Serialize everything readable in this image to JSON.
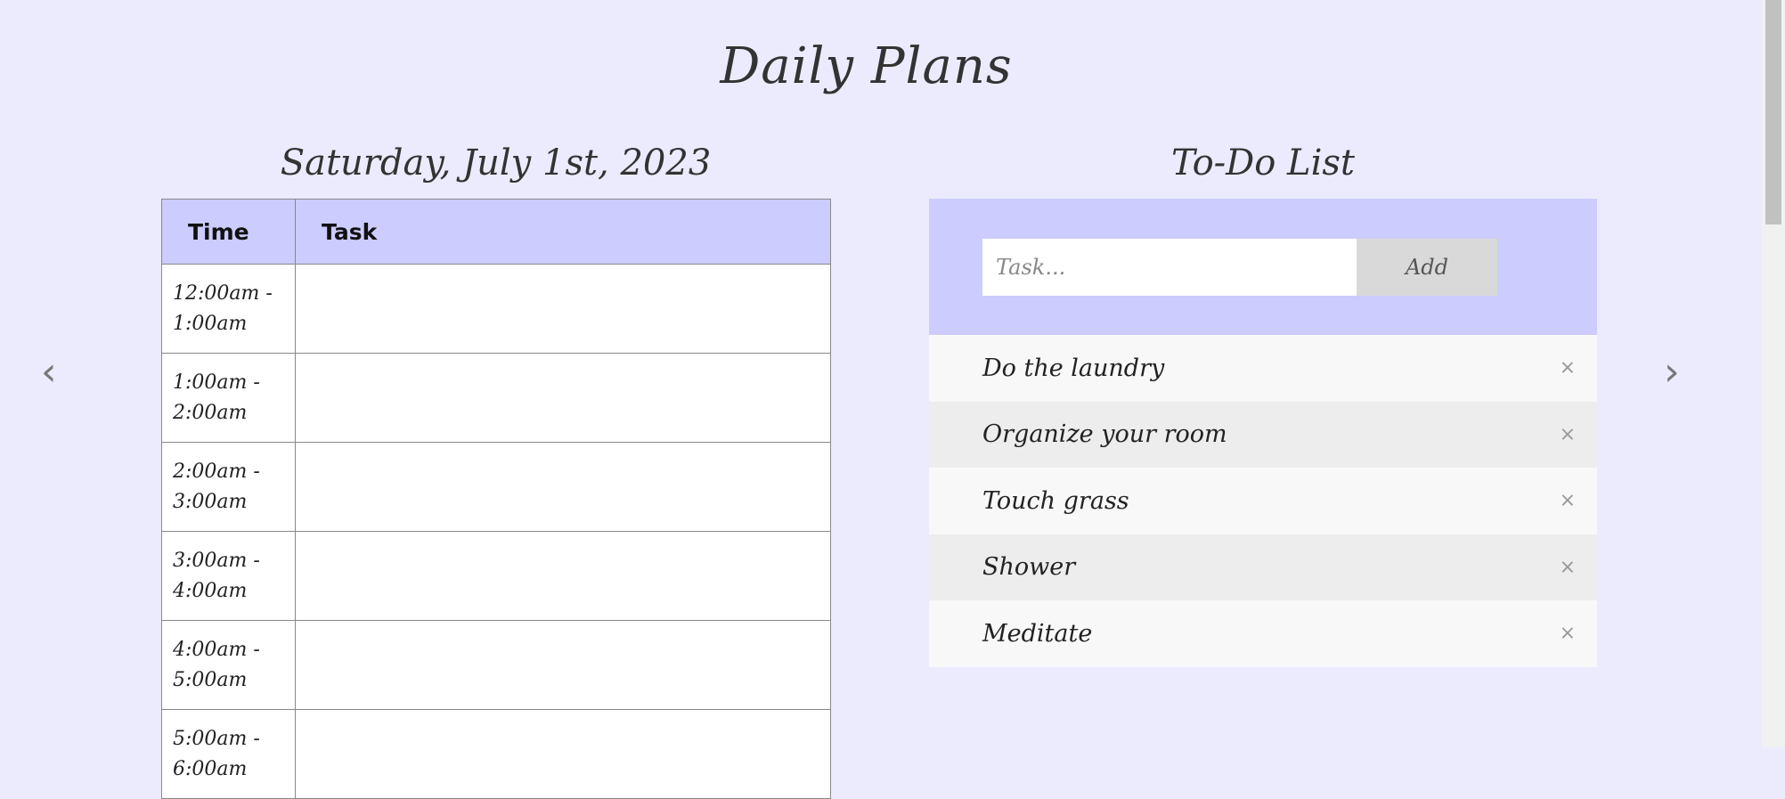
{
  "page": {
    "title": "Daily Plans",
    "colors": {
      "background": "#ecebfe",
      "accent": "#ccccfe"
    }
  },
  "schedule": {
    "date": "Saturday, July 1st, 2023",
    "headers": {
      "time": "Time",
      "task": "Task"
    },
    "rows": [
      {
        "time": "12:00am - 1:00am",
        "task": ""
      },
      {
        "time": "1:00am - 2:00am",
        "task": ""
      },
      {
        "time": "2:00am - 3:00am",
        "task": ""
      },
      {
        "time": "3:00am - 4:00am",
        "task": ""
      },
      {
        "time": "4:00am - 5:00am",
        "task": ""
      },
      {
        "time": "5:00am - 6:00am",
        "task": ""
      }
    ]
  },
  "nav": {
    "prev": "‹",
    "next": "›"
  },
  "todo": {
    "title": "To-Do List",
    "input_placeholder": "Task...",
    "add_label": "Add",
    "remove_glyph": "×",
    "items": [
      "Do the laundry",
      "Organize your room",
      "Touch grass",
      "Shower",
      "Meditate"
    ]
  }
}
